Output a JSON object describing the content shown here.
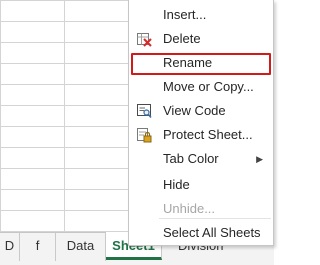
{
  "sheet_tabs": [
    {
      "label": "D",
      "active": false
    },
    {
      "label": "f",
      "active": false
    },
    {
      "label": "Data",
      "active": false
    },
    {
      "label": "Sheet1",
      "active": true
    },
    {
      "label": "Division",
      "active": false
    }
  ],
  "context_menu": {
    "items": [
      {
        "label": "Insert...",
        "icon": "none",
        "disabled": false
      },
      {
        "label": "Delete",
        "icon": "delete-sheet-icon",
        "disabled": false
      },
      {
        "label": "Rename",
        "icon": "none",
        "disabled": false,
        "highlighted": true
      },
      {
        "label": "Move or Copy...",
        "icon": "none",
        "disabled": false
      },
      {
        "label": "View Code",
        "icon": "view-code-icon",
        "disabled": false
      },
      {
        "label": "Protect Sheet...",
        "icon": "protect-sheet-icon",
        "disabled": false
      },
      {
        "label": "Tab Color",
        "icon": "none",
        "disabled": false,
        "submenu": true
      },
      {
        "label": "Hide",
        "icon": "none",
        "disabled": false
      },
      {
        "label": "Unhide...",
        "icon": "none",
        "disabled": true
      },
      {
        "label": "Select All Sheets",
        "icon": "none",
        "disabled": false
      }
    ]
  },
  "colors": {
    "accent_green": "#217346",
    "highlight_red": "#d11a1a"
  }
}
